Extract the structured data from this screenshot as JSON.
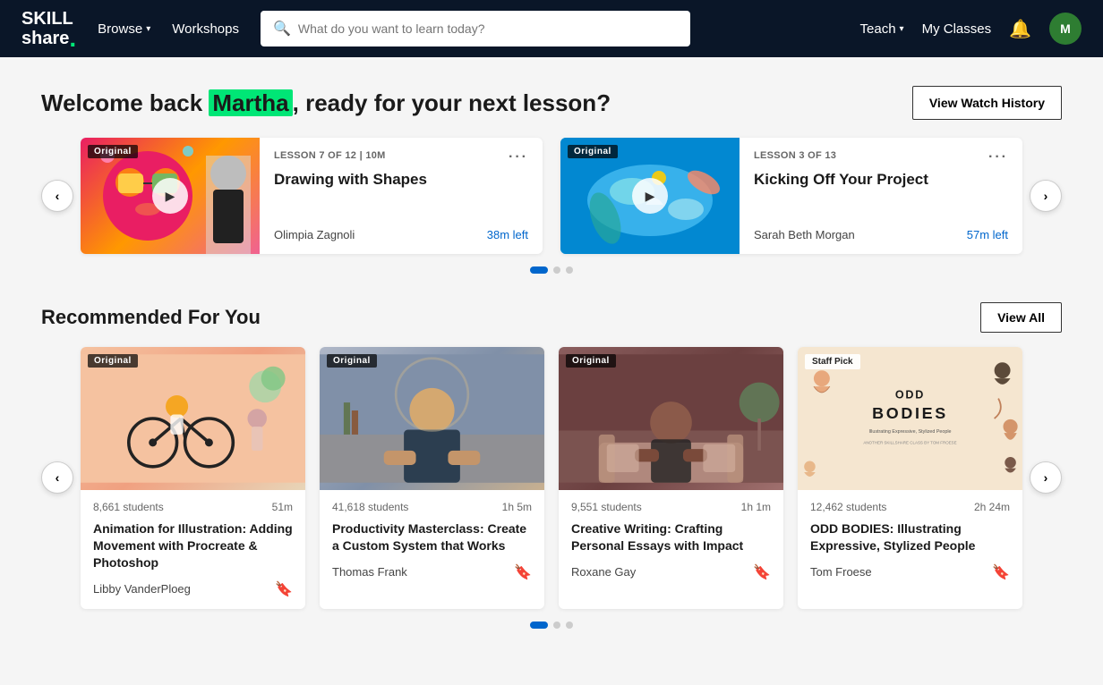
{
  "nav": {
    "logo_line1": "SKILL",
    "logo_line2": "share.",
    "browse_label": "Browse",
    "workshops_label": "Workshops",
    "search_placeholder": "What do you want to learn today?",
    "teach_label": "Teach",
    "my_classes_label": "My Classes",
    "avatar_initials": "M"
  },
  "welcome": {
    "prefix": "Welcome back ",
    "name": "Martha",
    "suffix": ", ready for your next lesson?",
    "view_history_btn": "View Watch History"
  },
  "lessons": [
    {
      "meta": "LESSON 7 OF 12 | 10M",
      "title": "Drawing with Shapes",
      "instructor": "Olimpia Zagnoli",
      "time_left": "38m left",
      "badge": "Original",
      "thumb_class": "lesson-thumb-1"
    },
    {
      "meta": "LESSON 3 OF 13",
      "title": "Kicking Off Your Project",
      "instructor": "Sarah Beth Morgan",
      "time_left": "57m left",
      "badge": "Original",
      "thumb_class": "lesson-thumb-2"
    }
  ],
  "recommended": {
    "title": "Recommended For You",
    "view_all_btn": "View All",
    "courses": [
      {
        "students": "8,661 students",
        "duration": "51m",
        "title": "Animation for Illustration: Adding Movement with Procreate & Photoshop",
        "instructor": "Libby VanderPloeg",
        "badge": "Original",
        "thumb_class": "course-thumb-1"
      },
      {
        "students": "41,618 students",
        "duration": "1h 5m",
        "title": "Productivity Masterclass: Create a Custom System that Works",
        "instructor": "Thomas Frank",
        "badge": "Original",
        "thumb_class": "course-thumb-2"
      },
      {
        "students": "9,551 students",
        "duration": "1h 1m",
        "title": "Creative Writing: Crafting Personal Essays with Impact",
        "instructor": "Roxane Gay",
        "badge": "Original",
        "thumb_class": "course-thumb-3"
      },
      {
        "students": "12,462 students",
        "duration": "2h 24m",
        "title": "ODD BODIES: Illustrating Expressive, Stylized People",
        "instructor": "Tom Froese",
        "badge": "Staff Pick",
        "thumb_class": "course-thumb-4"
      }
    ]
  },
  "carousel_dots": {
    "welcome_active": 0,
    "recommended_active": 0,
    "total": 3
  },
  "colors": {
    "name_highlight": "#00e676",
    "nav_bg": "#0a1628",
    "time_left_color": "#0066cc",
    "accent": "#0066cc"
  }
}
